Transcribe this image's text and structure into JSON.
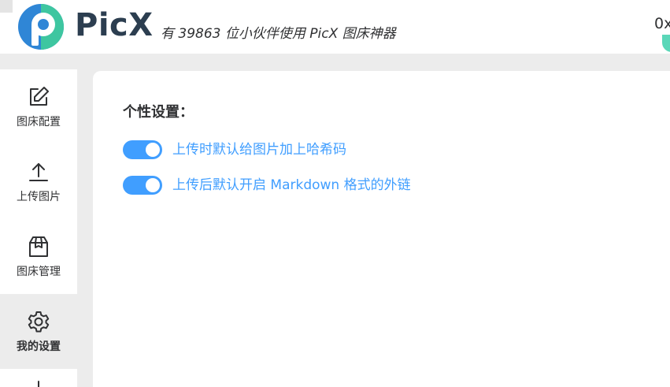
{
  "app": {
    "name": "PicX",
    "slogan": "有 39863 位小伙伴使用 PicX 图床神器",
    "user_link": "0x"
  },
  "sidebar": {
    "items": [
      {
        "label": "图床配置",
        "icon": "edit-icon",
        "active": false
      },
      {
        "label": "上传图片",
        "icon": "upload-icon",
        "active": false
      },
      {
        "label": "图床管理",
        "icon": "box-icon",
        "active": false
      },
      {
        "label": "我的设置",
        "icon": "gear-icon",
        "active": true
      }
    ]
  },
  "settings": {
    "title": "个性设置：",
    "options": [
      {
        "label": "上传时默认给图片加上哈希码",
        "enabled": true
      },
      {
        "label": "上传后默认开启 Markdown 格式的外链",
        "enabled": true
      }
    ]
  },
  "colors": {
    "accent": "#409eff",
    "brand_text": "#2c3e50",
    "logo_blue": "#2f86d6",
    "logo_green": "#3ec6a0",
    "background": "#ececec"
  }
}
